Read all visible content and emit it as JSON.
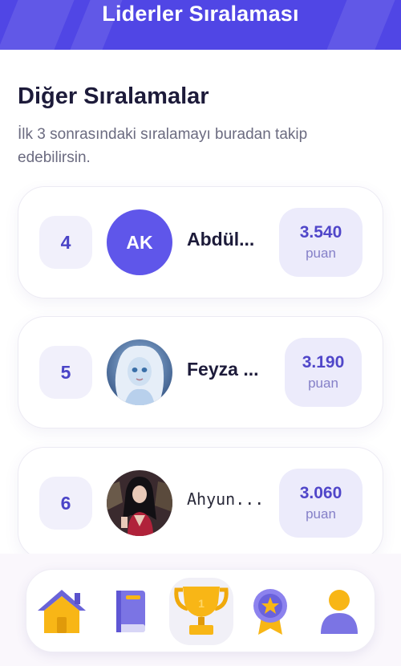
{
  "header": {
    "title": "Liderler Sıralaması"
  },
  "section": {
    "title": "Diğer Sıralamalar",
    "subtitle": "İlk 3 sonrasındaki sıralamayı buradan takip edebilirsin."
  },
  "leaders": [
    {
      "rank": "4",
      "avatar_initials": "AK",
      "avatar_type": "initials",
      "name": "Abdül...",
      "points": "3.540",
      "unit": "puan"
    },
    {
      "rank": "5",
      "avatar_type": "image",
      "avatar_icon": "fairy-avatar",
      "name": "Feyza ...",
      "points": "3.190",
      "unit": "puan"
    },
    {
      "rank": "6",
      "avatar_type": "image",
      "avatar_icon": "vampire-avatar",
      "name": "Ahyun...",
      "points": "3.060",
      "unit": "puan"
    }
  ],
  "nav": {
    "items": [
      {
        "icon": "home-icon",
        "active": false
      },
      {
        "icon": "book-icon",
        "active": false
      },
      {
        "icon": "trophy-icon",
        "active": true
      },
      {
        "icon": "badge-icon",
        "active": false
      },
      {
        "icon": "profile-icon",
        "active": false
      }
    ]
  },
  "colors": {
    "accent": "#5046e5",
    "card_bg": "#ffffff",
    "chip_bg": "#ecebfb",
    "text_dark": "#1d1b3a"
  }
}
